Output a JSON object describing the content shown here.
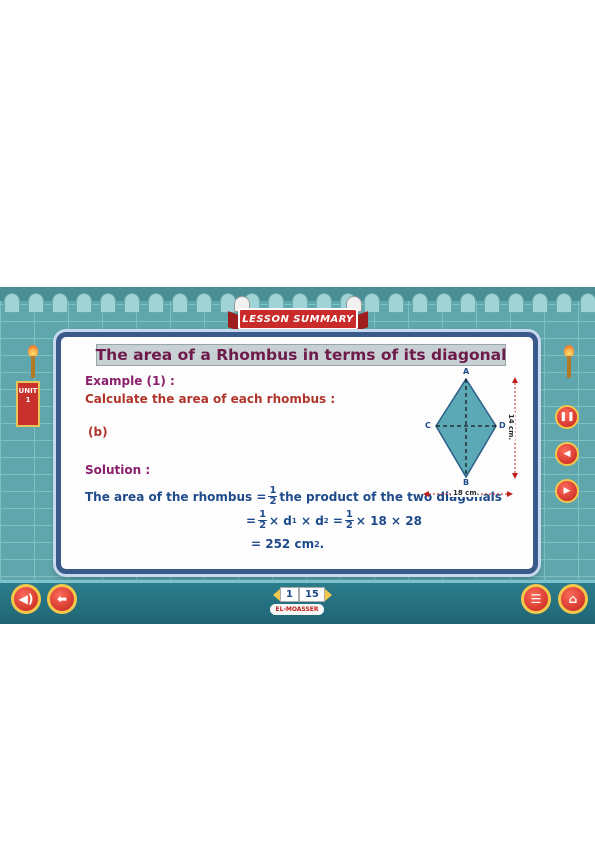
{
  "header": {
    "ribbon_label": "LESSON SUMMARY"
  },
  "side": {
    "unit_label": "UNIT",
    "unit_number": "1"
  },
  "board": {
    "title": "The area of a Rhombus in terms of its diagonal",
    "example_label": "Example (1) :",
    "instruction": "Calculate the area of each rhombus :",
    "part_label": "(b)",
    "solution_label": "Solution :",
    "line1_start": "The area of the rhombus =",
    "line1_end": "the product of the two diagonals",
    "frac_num": "1",
    "frac_den": "2",
    "line2_eq": "=",
    "line2_d": "d",
    "line2_sub1": "1",
    "line2_sub2": "2",
    "line2_times": "×",
    "line2_end": "× 18 × 28",
    "line3": "= 252 cm",
    "line3_sup": "2",
    "line3_end": "."
  },
  "diagram": {
    "vertex_a": "A",
    "vertex_b": "B",
    "vertex_c": "C",
    "vertex_d": "D",
    "horizontal_dim": "18 cm.",
    "vertical_dim": "14 cm."
  },
  "pager": {
    "current": "1",
    "total": "15"
  },
  "footer": {
    "logo": "EL-MOASSER"
  },
  "colors": {
    "title_text": "#6d1a4a",
    "equation_text": "#1f4b8a",
    "button_red": "#c0201a",
    "board_border": "#3b5a8c"
  },
  "icons": {
    "pause": "pause-icon",
    "rewind": "rewind-icon",
    "forward": "forward-icon",
    "sound": "speaker-icon",
    "back": "back-arrow-icon",
    "menu": "menu-icon",
    "home": "home-icon"
  }
}
